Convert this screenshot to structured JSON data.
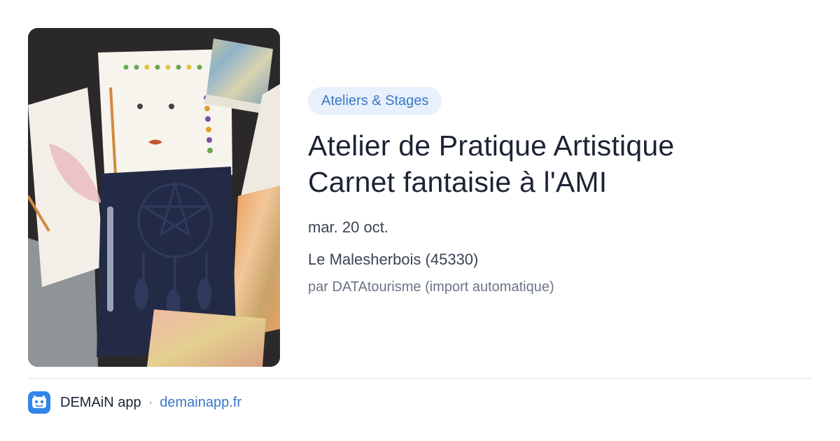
{
  "event": {
    "category": "Ateliers & Stages",
    "title_line1": "Atelier de Pratique Artistique",
    "title_line2": "Carnet fantaisie à l'AMI",
    "date": "mar. 20 oct.",
    "location": "Le Malesherbois (45330)",
    "source": "par DATAtourisme (import automatique)"
  },
  "footer": {
    "app_name": "DEMAiN app",
    "separator": "·",
    "domain": "demainapp.fr"
  },
  "colors": {
    "accent": "#3a78c9",
    "badge_bg": "#e8f0fb",
    "title": "#1c2434",
    "app_icon": "#2f86e8"
  },
  "icons": {
    "app_logo": "app-logo-icon"
  }
}
